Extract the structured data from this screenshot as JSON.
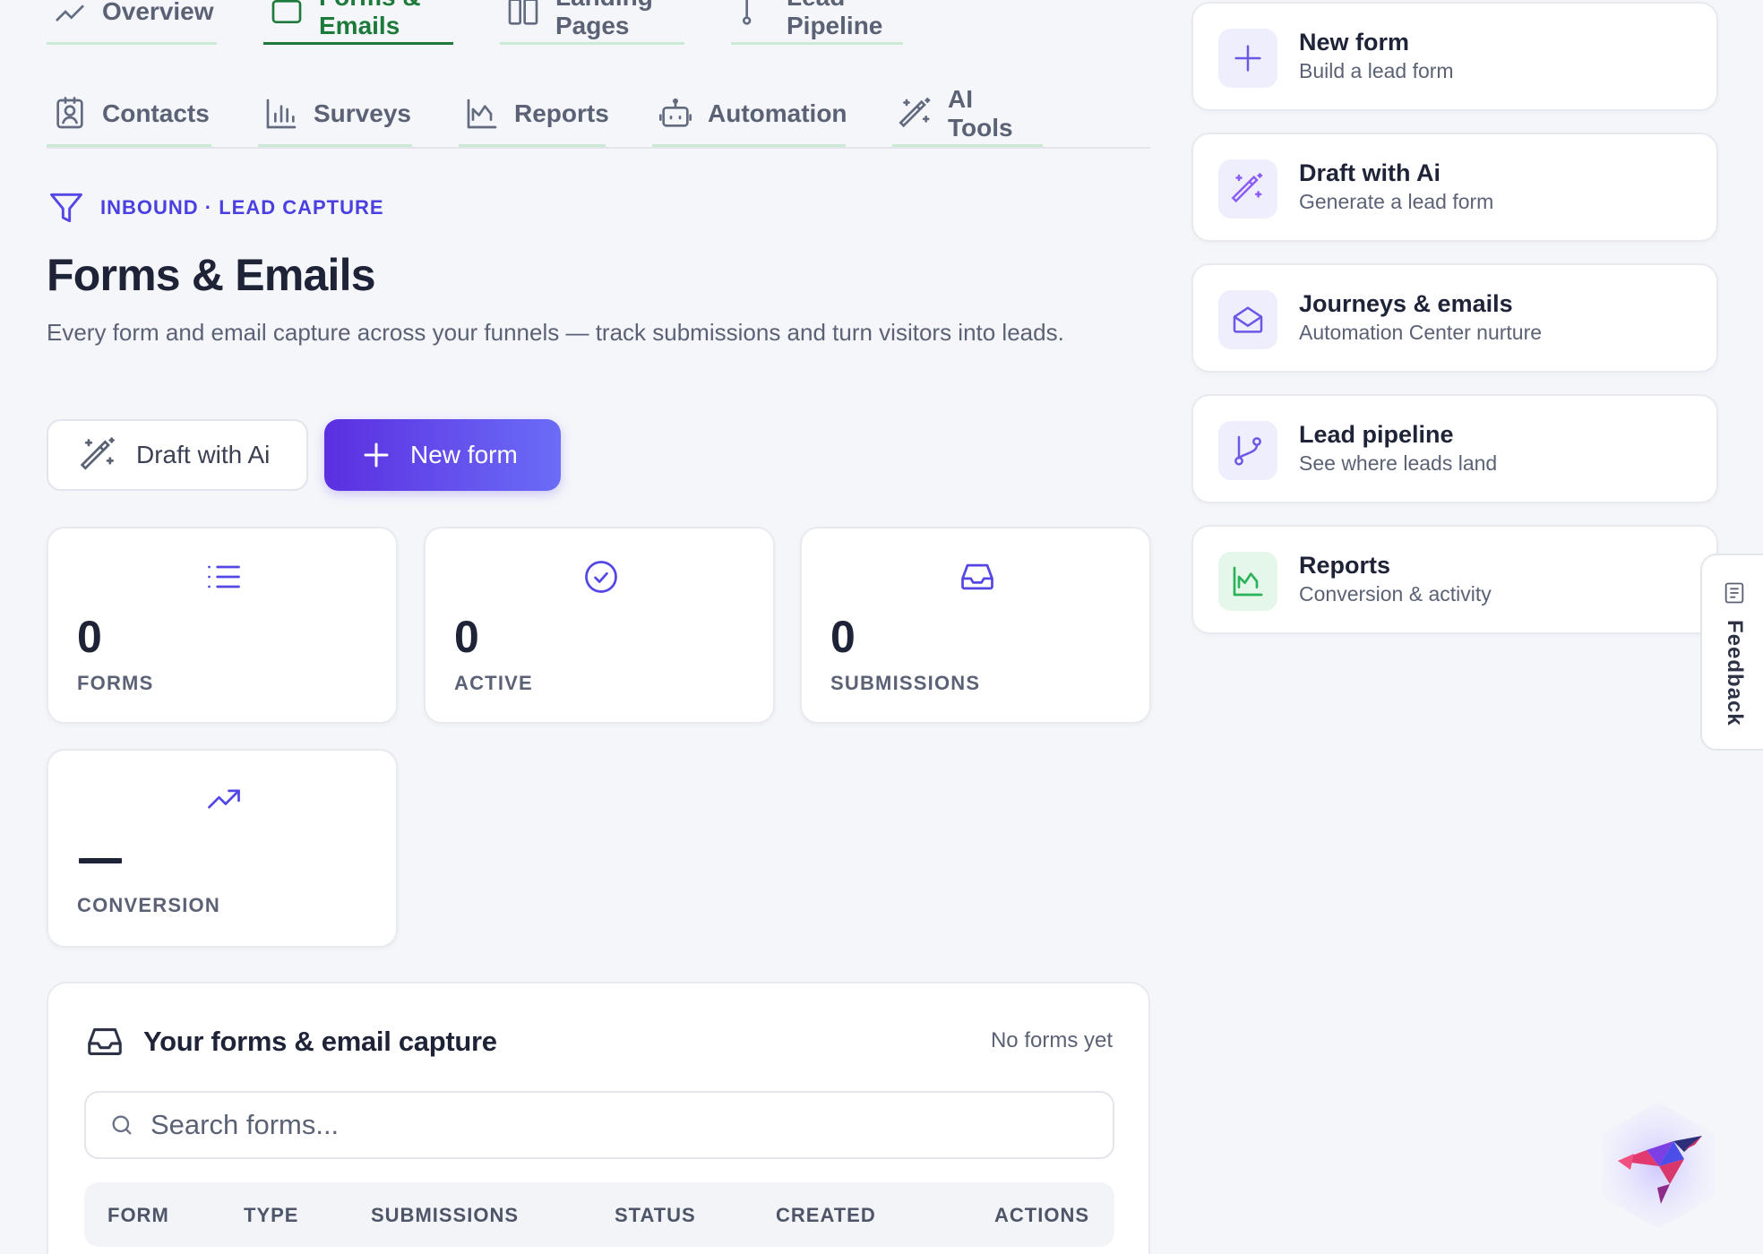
{
  "nav": {
    "top_tabs": [
      {
        "label": "Overview"
      },
      {
        "label": "Forms & Emails"
      },
      {
        "label": "Landing Pages"
      },
      {
        "label": "Lead Pipeline"
      }
    ],
    "tabs": [
      {
        "label": "Contacts"
      },
      {
        "label": "Surveys"
      },
      {
        "label": "Reports"
      },
      {
        "label": "Automation"
      },
      {
        "label": "AI Tools"
      }
    ]
  },
  "header": {
    "eyebrow": "INBOUND · LEAD CAPTURE",
    "title": "Forms & Emails",
    "subtitle": "Every form and email capture across your funnels — track submissions and turn visitors into leads."
  },
  "actions": {
    "draft_label": "Draft with Ai",
    "new_label": "New form"
  },
  "stats": {
    "forms": {
      "value": "0",
      "label": "FORMS"
    },
    "active": {
      "value": "0",
      "label": "ACTIVE"
    },
    "submissions": {
      "value": "0",
      "label": "SUBMISSIONS"
    },
    "conversion": {
      "value": "—",
      "label": "CONVERSION"
    }
  },
  "panel": {
    "title": "Your forms & email capture",
    "meta": "No forms yet",
    "search_placeholder": "Search forms...",
    "columns": [
      "FORM",
      "TYPE",
      "SUBMISSIONS",
      "STATUS",
      "CREATED",
      "ACTIONS"
    ]
  },
  "quick": [
    {
      "title": "New form",
      "subtitle": "Build a lead form",
      "icon": "plus-icon"
    },
    {
      "title": "Draft with Ai",
      "subtitle": "Generate a lead form",
      "icon": "magic-wand-icon"
    },
    {
      "title": "Journeys & emails",
      "subtitle": "Automation Center nurture",
      "icon": "envelope-open-icon"
    },
    {
      "title": "Lead pipeline",
      "subtitle": "See where leads land",
      "icon": "git-branch-icon"
    },
    {
      "title": "Reports",
      "subtitle": "Conversion & activity",
      "icon": "chart-icon"
    }
  ],
  "feedback": {
    "label": "Feedback"
  },
  "colors": {
    "accent": "#5447e6",
    "active_tab": "#1d7a3b",
    "tab_underline": "#cbead3",
    "background": "#f5f6fa"
  }
}
